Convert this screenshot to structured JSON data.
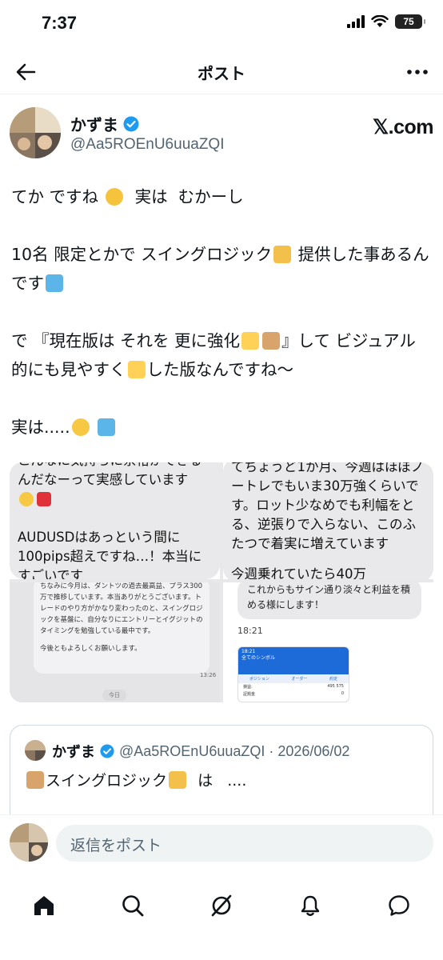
{
  "status": {
    "time": "7:37",
    "battery": "75"
  },
  "header": {
    "title": "ポスト"
  },
  "author": {
    "name": "かずま",
    "handle": "@Aa5ROEnU6uuaZQI",
    "source": "𝕏.com"
  },
  "post": {
    "lines": [
      "てか ですね",
      "実は  むかーし",
      "10名 限定とかで スイングロジック",
      "提供した事あるんです",
      "で 『現在版は それを 更に強化",
      "』して ビジュアル的にも見やすく",
      "した版なんですね〜",
      "実は....."
    ]
  },
  "media": {
    "tile1_text": "こんなに気持ちに余裕ができるんだなーって実感しています",
    "tile1_text2": "AUDUSDはあっという間に100pips超えですね…！本当にすごいです",
    "tile2_text": "てちょうど1か月、今週はほぼノートレでもいま30万強くらいです。ロット少なめでも利幅をとる、逆張りで入らない、このふたつで着実に増えています",
    "tile2_text2": "今週乗れていたら40万",
    "tile3_text": "ちなみに今月は、ダントツの過去最高益、プラス300万で推移しています。本当ありがとうございます。トレードのやり方がかなり変わったのと、スイングロジックを基盤に、自分なりにエントリーとイグジットのタイミングを勉強している最中です。",
    "tile3_text2": "今後ともよろしくお願いします。",
    "tile3_time": "13:26",
    "tile3_today": "今日",
    "tile4_text": "これからもサイン通り淡々と利益を積める様にします！",
    "tile4_time": "18:21",
    "tile4_app_time": "18:21",
    "tile4_app_title": "全てのシンボル",
    "tile4_tab1": "ポジション",
    "tile4_tab2": "オーダー",
    "tile4_tab3": "約定",
    "tile4_row1_label": "損益:",
    "tile4_row1_value": "495 575",
    "tile4_row2_label": "証拠金",
    "tile4_row2_value": "0"
  },
  "quote": {
    "name": "かずま",
    "handle_date": "@Aa5ROEnU6uuaZQI · 2026/06/02",
    "text_a": "スイングロジック",
    "text_b": "  は   ...."
  },
  "reply": {
    "placeholder": "返信をポスト"
  },
  "nav": [
    "home-icon",
    "search-icon",
    "grok-icon",
    "notifications-icon",
    "messages-icon"
  ]
}
